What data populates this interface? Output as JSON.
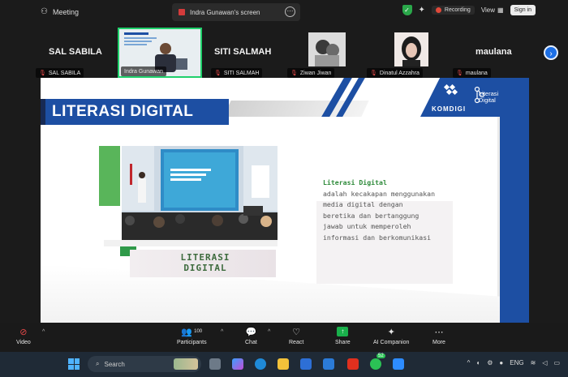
{
  "topbar": {
    "meeting_label": "Meeting",
    "share_label": "Indra Gunawan's screen",
    "recording_label": "Recording",
    "view_label": "View",
    "signin_label": "Sign in"
  },
  "participants": [
    {
      "display": "SAL SABILA",
      "label": "SAL SABILA"
    },
    {
      "display": "",
      "label": "Indra Gunawan"
    },
    {
      "display": "SITI SALMAH",
      "label": "SITI SALMAH"
    },
    {
      "display": "",
      "label": "Ziwan Jiwan"
    },
    {
      "display": "",
      "label": "Dinatul Azzahra"
    },
    {
      "display": "maulana",
      "label": "maulana"
    }
  ],
  "slide": {
    "title": "LITERASI DIGITAL",
    "brand": "KOMDIGI",
    "logo_line1": "Literasi",
    "logo_line2": "Digital",
    "caption_line1": "LITERASI",
    "caption_line2": "DIGITAL",
    "desc_heading": "Literasi Digital",
    "desc_body": "adalah kecakapan menggunakan media digital dengan beretika dan bertanggung jawab untuk memperoleh informasi dan berkomunikasi"
  },
  "toolbar": {
    "video": "Video",
    "participants": "Participants",
    "participants_count": "100",
    "chat": "Chat",
    "react": "React",
    "share": "Share",
    "companion": "AI Companion",
    "more": "More"
  },
  "taskbar": {
    "search_placeholder": "Search",
    "lang": "ENG",
    "whatsapp_badge": "52"
  },
  "colors": {
    "slide_blue": "#1d4fa3",
    "accent_green": "#59b55a",
    "active_speaker": "#1fd06b",
    "recording": "#e0493a"
  }
}
